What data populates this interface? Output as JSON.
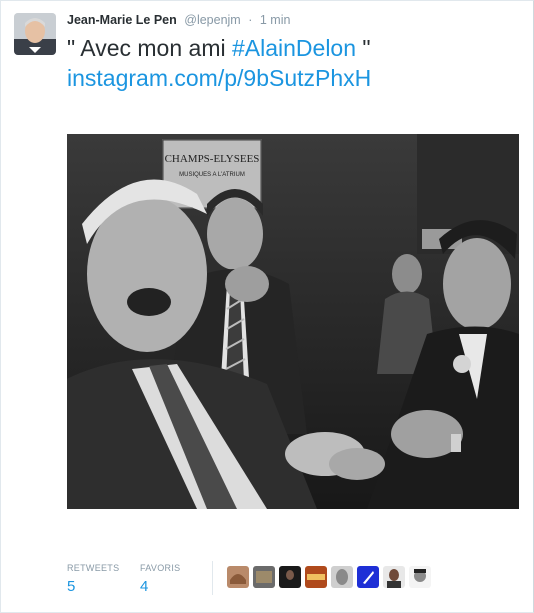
{
  "tweet": {
    "author_name": "Jean-Marie Le Pen",
    "author_handle": "@lepenjm",
    "separator": "·",
    "time": "1 min",
    "text_prefix": "\" Avec mon ami ",
    "hashtag": "#AlainDelon",
    "text_suffix": " \"",
    "link": "instagram.com/p/9bSutzPhxH"
  },
  "photo": {
    "sign_line1": "CHAMPS-ELYSEES",
    "sign_line2": "MUSIQUES A L'ATRIUM"
  },
  "stats": {
    "retweets_label": "RETWEETS",
    "retweets_value": "5",
    "favorites_label": "FAVORIS",
    "favorites_value": "4"
  },
  "favoriters": [
    {
      "icon": "avatar-1",
      "color": "#b98a6a"
    },
    {
      "icon": "avatar-2",
      "color": "#6b6b6b"
    },
    {
      "icon": "avatar-3",
      "color": "#1a1a1a"
    },
    {
      "icon": "avatar-4",
      "color": "#b04a1c"
    },
    {
      "icon": "avatar-5",
      "color": "#cfcfcf"
    },
    {
      "icon": "avatar-6",
      "color": "#1e2fd6"
    },
    {
      "icon": "avatar-7",
      "color": "#6f4a3a"
    },
    {
      "icon": "avatar-8",
      "color": "#8a8a8a"
    }
  ],
  "colors": {
    "link": "#1b95e0",
    "meta": "#8899a6",
    "text": "#292f33"
  }
}
